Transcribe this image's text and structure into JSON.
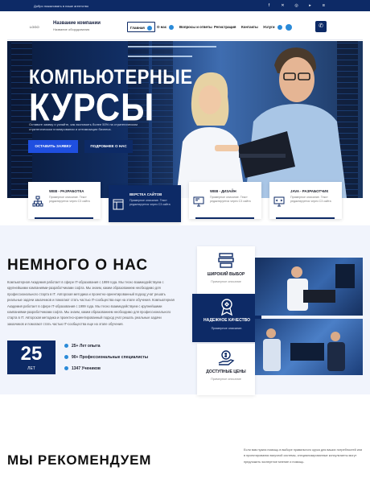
{
  "topbar": {
    "text": "Добро пожаловать в наше агентство",
    "social_icons": [
      "facebook-icon",
      "twitter-icon",
      "instagram-icon",
      "youtube-icon",
      "vk-icon"
    ]
  },
  "header": {
    "logo": "LOGO",
    "company_name": "Название компании",
    "company_tagline": "Название оборудования",
    "nav": [
      {
        "label": "Главная",
        "active": true,
        "dropdown": true
      },
      {
        "label": "О нас",
        "active": false,
        "dropdown": true
      },
      {
        "label": "Вопросы и ответы",
        "active": false,
        "dropdown": false
      },
      {
        "label": "Регистрация",
        "active": false,
        "dropdown": false
      },
      {
        "label": "Контакты",
        "active": false,
        "dropdown": false
      },
      {
        "label": "Услуги",
        "active": false,
        "dropdown": true
      }
    ],
    "phone_icon": "phone-icon",
    "search_icon": "search-icon"
  },
  "hero": {
    "title_line1": "КОМПЬЮТЕРНЫЕ",
    "title_line2": "КУРСЫ",
    "description": "Оставьте заявку и узнайте, как экономить более 50% на стратегическом стратегическом планировании и оптимизации бизнеса.",
    "btn_primary": "ОСТАВИТЬ ЗАЯВКУ",
    "btn_secondary": "ПОДРОБНЕЕ О НАС"
  },
  "services": [
    {
      "title": "WEB - РАЗРАБОТКА",
      "desc": "Примерное описание. Текст редактируется через С3 сайта",
      "icon": "org-chart-icon",
      "dark": false
    },
    {
      "title": "ВЕРСТКА САЙТОВ",
      "desc": "Примерное описание. Текст редактируется через С3 сайта",
      "icon": "layout-icon",
      "dark": true
    },
    {
      "title": "WEB - ДИЗАЙН",
      "desc": "Примерное описание. Текст редактируется через С3 сайта",
      "icon": "monitor-design-icon",
      "dark": false
    },
    {
      "title": "JAVA - РАЗРАБОТЧИК",
      "desc": "Примерное описание. Текст редактируется через С3 сайта",
      "icon": "monitor-code-icon",
      "dark": false
    }
  ],
  "about": {
    "title": "НЕМНОГО О НАС",
    "text": "Компьютерная Академия работает в сфере IT-образования с 1999 года. Мы тесно взаимодействуем с крупнейшими компаниями-разработчиками софта. Мы знаем, каким образованием необходимо для профессионального старта в IT. Авторская методика и проектно-ориентированный подход учат решать реальные задачи заказчиков и помогают стать частью IT-сообщества еще на этапе обучения. Компьютерная Академия работает в сфере IT-образования с 1999 года. Мы тесно взаимодействуем с крупнейшими компаниями-разработчиками софта. Мы знаем, каким образованием необходимо для профессионального старта в IT. Авторская методика и проектно-ориентированный подход учат решать реальные задачи заказчиков и помогают стать частью IT-сообщества еще на этапе обучения.",
    "years_number": "25",
    "years_label": "ЛЕТ",
    "stats": [
      "25+ Лет опыта",
      "90+ Профессиональные специалисты",
      "1347 Учеников"
    ]
  },
  "features": [
    {
      "title": "ШИРОКИЙ ВЫБОР",
      "desc": "Примерное описание",
      "icon": "books-icon",
      "dark": false
    },
    {
      "title": "НАДЕЖНОЕ КАЧЕСТВО",
      "desc": "Примерное описание.",
      "icon": "award-medal-icon",
      "dark": true
    },
    {
      "title": "ДОСТУПНЫЕ ЦЕНЫ",
      "desc": "Примерное описание",
      "icon": "price-hand-icon",
      "dark": false
    }
  ],
  "recommend": {
    "title": "МЫ РЕКОМЕНДУЕМ",
    "text": "Если вам нужна помощь в выборе правильного курса для ваших потребностей или в проектировании вагучной системы, специализированные консультанты могут предложить экспертное мнение и помощь."
  },
  "colors": {
    "primary": "#0d2a66",
    "accent": "#2a8ad8",
    "section_bg": "#f1f4fc"
  }
}
